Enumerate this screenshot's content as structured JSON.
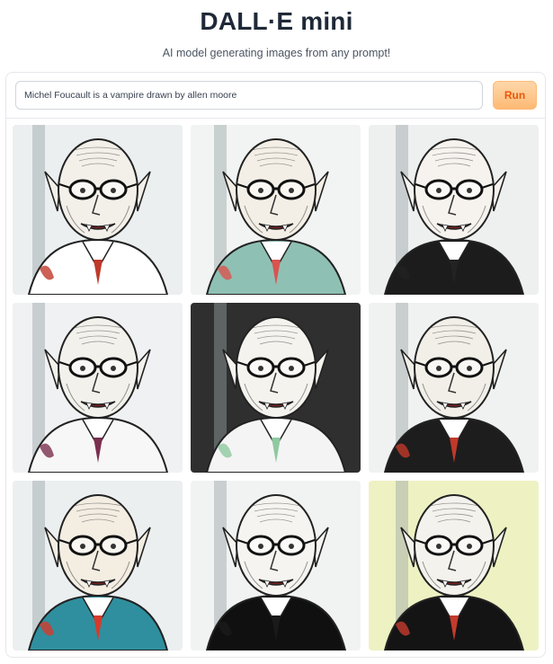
{
  "header": {
    "title": "DALL·E mini",
    "subtitle": "AI model generating images from any prompt!"
  },
  "prompt": {
    "value": "Michel Foucault is a vampire drawn by allen moore",
    "run_label": "Run"
  },
  "results": {
    "images": [
      {
        "background": "#eceff0",
        "accent": "#c0392b",
        "clothing": "#ffffff",
        "head": "#f3efe9",
        "glasses": true
      },
      {
        "background": "#f1f4f2",
        "accent": "#d9534f",
        "clothing": "#8fc0b4",
        "head": "#f4efe6",
        "glasses": true
      },
      {
        "background": "#eef0f0",
        "accent": "#222222",
        "clothing": "#1c1c1c",
        "head": "#f6f3ee",
        "glasses": true
      },
      {
        "background": "#eff1f2",
        "accent": "#7a2f4f",
        "clothing": "#f7f7f7",
        "head": "#f3f1ec",
        "glasses": true
      },
      {
        "background": "#2f2f2f",
        "accent": "#8ec9a0",
        "clothing": "#f4f4f4",
        "head": "#f5f3ee",
        "glasses": true
      },
      {
        "background": "#f0f2f1",
        "accent": "#c0392b",
        "clothing": "#1d1d1d",
        "head": "#f2efe9",
        "glasses": true
      },
      {
        "background": "#eceff0",
        "accent": "#d63a2c",
        "clothing": "#2f8f9e",
        "head": "#f3ede2",
        "glasses": true
      },
      {
        "background": "#f1f3f3",
        "accent": "#1a1a1a",
        "clothing": "#101010",
        "head": "#f5f4f0",
        "glasses": true
      },
      {
        "background": "#eef2c2",
        "accent": "#c43b2d",
        "clothing": "#141414",
        "head": "#f4f2ec",
        "glasses": true
      }
    ]
  }
}
